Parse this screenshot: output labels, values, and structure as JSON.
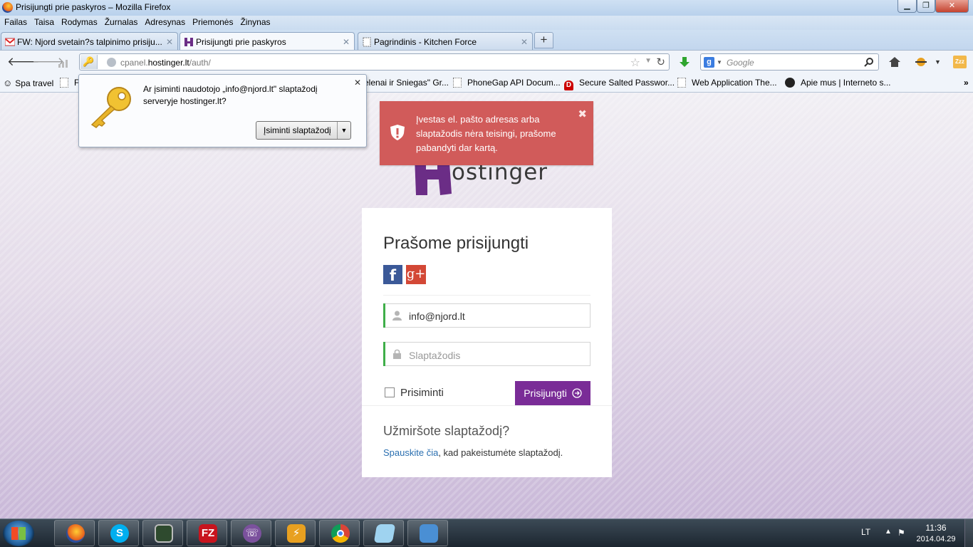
{
  "window": {
    "title": "Prisijungti prie paskyros – Mozilla Firefox"
  },
  "menu": [
    "Failas",
    "Taisa",
    "Rodymas",
    "Žurnalas",
    "Adresynas",
    "Priemonės",
    "Žinynas"
  ],
  "tabs": [
    {
      "label": "FW: Njord svetain?s talpinimo prisiju...",
      "icon": "gmail-icon"
    },
    {
      "label": "Prisijungti prie paskyros",
      "icon": "hostinger-icon",
      "active": true
    },
    {
      "label": "Pagrindinis - Kitchen Force",
      "icon": "page-icon"
    }
  ],
  "address": {
    "prefix": "cpanel.",
    "domain": "hostinger.lt",
    "path": "/auth/"
  },
  "search": {
    "placeholder": "Google"
  },
  "bookmarks": [
    {
      "label": "Spa travel",
      "icon": "smiley-icon"
    },
    {
      "label": "Fl",
      "icon": "page-icon"
    },
    {
      "label": "elenai ir Sniegas\" Gr...",
      "icon": "page-icon"
    },
    {
      "label": "PhoneGap API Docum...",
      "icon": "page-icon"
    },
    {
      "label": "Secure Salted Passwor...",
      "icon": "red-d-icon"
    },
    {
      "label": "Web Application The...",
      "icon": "page-icon"
    },
    {
      "label": "Apie mus | Interneto s...",
      "icon": "moon-icon"
    }
  ],
  "popup": {
    "message": "Ar įsiminti naudotojo „info@njord.lt\" slaptažodį serveryje hostinger.lt?",
    "button": "Įsiminti slaptažodį"
  },
  "alert": {
    "message": "Įvestas el. pašto adresas arba slaptažodis nėra teisingi, prašome pabandyti dar kartą."
  },
  "logo": {
    "text": "ostinger"
  },
  "login": {
    "title": "Prašome prisijungti",
    "email_value": "info@njord.lt",
    "password_placeholder": "Slaptažodis",
    "remember_label": "Prisiminti",
    "submit_label": "Prisijungti",
    "forgot_title": "Užmiršote slaptažodį?",
    "forgot_link": "Spauskite čia",
    "forgot_rest": ", kad pakeistumėte slaptažodį."
  },
  "tray": {
    "lang": "LT",
    "time": "11:36",
    "date": "2014.04.29"
  },
  "colors": {
    "brand_purple": "#7a2c97",
    "alert_red": "#d15b5a",
    "valid_green": "#3fae49",
    "facebook": "#3b5998",
    "google_plus": "#d34836"
  }
}
